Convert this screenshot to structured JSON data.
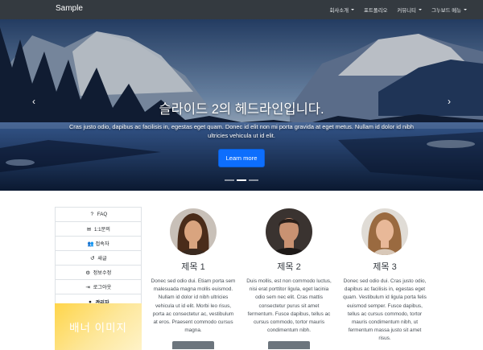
{
  "navbar": {
    "brand": "Sample",
    "items": [
      {
        "label": "회사소개",
        "dropdown": true
      },
      {
        "label": "포트폴리오",
        "dropdown": false
      },
      {
        "label": "커뮤니티",
        "dropdown": true
      },
      {
        "label": "그누보드 메뉴",
        "dropdown": true
      }
    ]
  },
  "carousel": {
    "heading": "슬라이드 2의 헤드라인입니다.",
    "text": "Cras justo odio, dapibus ac facilisis in, egestas eget quam. Donec id elit non mi porta gravida at eget metus. Nullam id dolor id nibh ultricies vehicula ut id elit.",
    "button": "Learn more",
    "prev_icon": "‹",
    "next_icon": "›",
    "indicators": 3,
    "active_index": 1
  },
  "sidebar": {
    "items": [
      {
        "icon": "question-icon",
        "glyph": "?",
        "label": "FAQ",
        "bold": false
      },
      {
        "icon": "comments-icon",
        "glyph": "✉",
        "label": "1:1문의",
        "bold": false
      },
      {
        "icon": "users-icon",
        "glyph": "👥",
        "label": "접속자",
        "bold": false
      },
      {
        "icon": "history-icon",
        "glyph": "↺",
        "label": "새글",
        "bold": false
      },
      {
        "icon": "gear-icon",
        "glyph": "⚙",
        "label": "정보수정",
        "bold": false
      },
      {
        "icon": "sign-out-icon",
        "glyph": "⇥",
        "label": "로그아웃",
        "bold": false
      },
      {
        "icon": "user-circle-icon",
        "glyph": "●",
        "label": "관리자",
        "bold": true
      }
    ]
  },
  "banner": {
    "label": "배너 이미지"
  },
  "profiles": [
    {
      "title": "제목 1",
      "text": "Donec sed odio dui. Etiam porta sem malesuada magna mollis euismod. Nullam id dolor id nibh ultricies vehicula ut id elit. Morbi leo risus, porta ac consectetur ac, vestibulum at eros. Praesent commodo cursus magna.",
      "skin": "#d9a47f",
      "hair": "#4a2c1a",
      "bg": "#c8c0b8"
    },
    {
      "title": "제목 2",
      "text": "Duis mollis, est non commodo luctus, nisi erat porttitor ligula, eget lacinia odio sem nec elit. Cras mattis consectetur purus sit amet fermentum. Fusce dapibus, tellus ac cursus commodo, tortor mauris condimentum nibh.",
      "skin": "#c99272",
      "hair": "#2a1f1a",
      "bg": "#3a3330"
    },
    {
      "title": "제목 3",
      "text": "Donec sed odio dui. Cras justo odio, dapibus ac facilisis in, egestas eget quam. Vestibulum id ligula porta felis euismod semper. Fusce dapibus, tellus ac cursus commodo, tortor mauris condimentum nibh, ut fermentum massa justo sit amet risus.",
      "skin": "#e8b898",
      "hair": "#9a6a40",
      "bg": "#e0dcd6"
    }
  ],
  "colors": {
    "navbar": "#343a40",
    "primary": "#0d6efd",
    "secondary": "#6c757d",
    "banner": "#ffd54a"
  }
}
